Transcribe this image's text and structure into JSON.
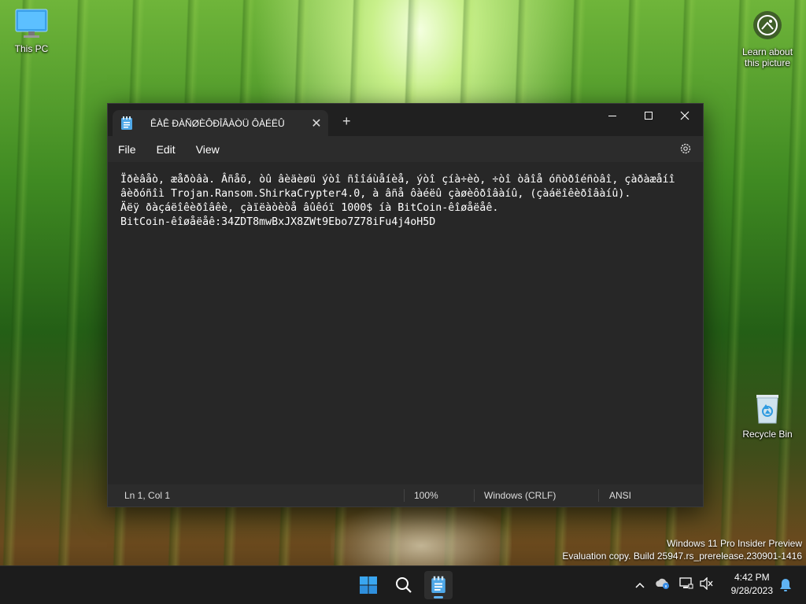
{
  "desktop": {
    "icons": [
      {
        "label": "This PC"
      },
      {
        "label": "Recycle Bin"
      }
    ],
    "spotlight": {
      "label_line1": "Learn about",
      "label_line2": "this picture"
    },
    "watermark": {
      "line1": "Windows 11 Pro Insider Preview",
      "line2": "Evaluation copy. Build 25947.rs_prerelease.230901-1416"
    }
  },
  "notepad": {
    "tab_title": "ÊÀÊ ÐÀÑØÈÔÐÎÂÀÒÜ ÔÀÉËÛ",
    "new_tab": "+",
    "menu": [
      "File",
      "Edit",
      "View"
    ],
    "lines": [
      "Ïðèâåò, æåðòâà. Âñåõ, òû âèäèøü ýòî ñîîáùåíèå, ýòî çíà÷èò, ÷òî òâîå óñòðîéñòâî, çàðàæåíî",
      "âèðóñîì Trojan.Ransom.ShirkaCrypter4.0, à âñå ôàéëû çàøèôðîâàíû, (çàáëîêèðîâàíû).",
      "Äëÿ ðàçáëîêèðîâêè, çàïëàòèòå âûêóï 1000$ íà BitCoin-êîøåëåê.",
      "BitCoin-êîøåëåê:34ZDT8mwBxJX8ZWt9Ebo7Z78iFu4j4oH5D"
    ],
    "status": {
      "position": "Ln 1, Col 1",
      "zoom": "100%",
      "line_ending": "Windows (CRLF)",
      "encoding": "ANSI"
    }
  },
  "taskbar": {
    "time": "4:42 PM",
    "date": "9/28/2023"
  },
  "colors": {
    "window_bg": "#202020",
    "editor_bg": "#272727",
    "taskbar_bg": "#1c1c1c",
    "accent": "#5fb2f2"
  }
}
